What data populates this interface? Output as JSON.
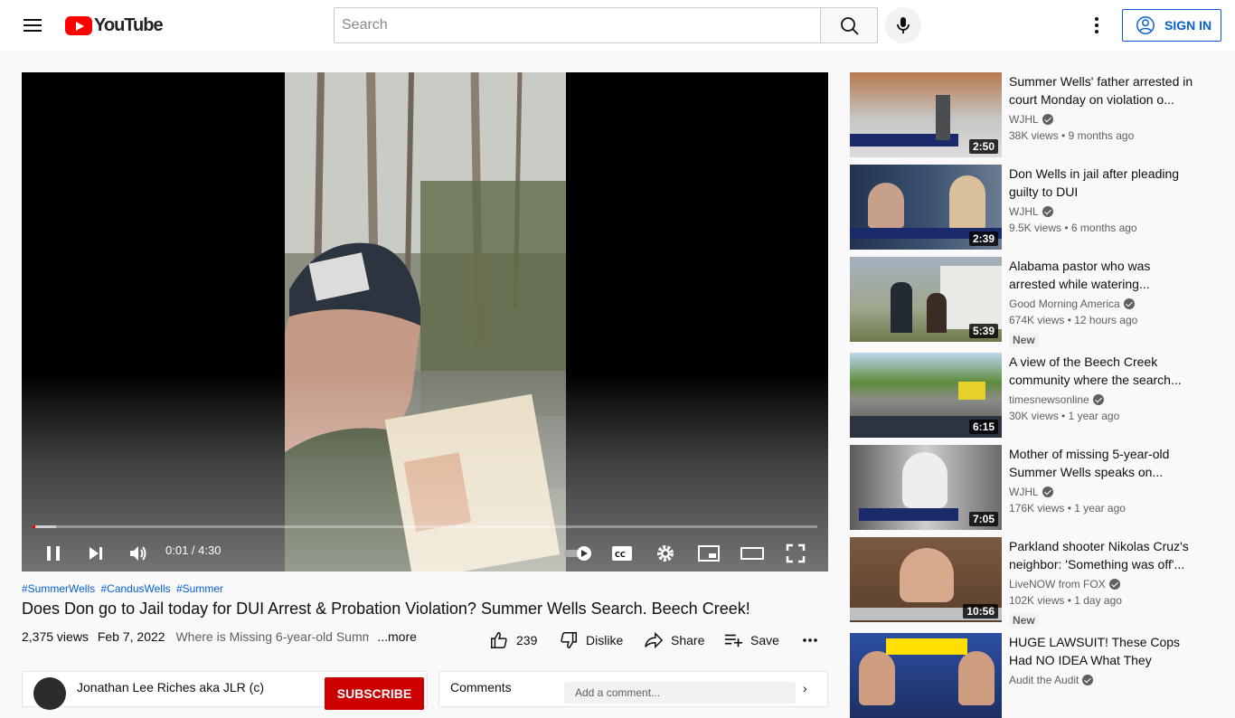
{
  "header": {
    "logo_text": "YouTube",
    "search_placeholder": "Search",
    "signin_label": "SIGN IN"
  },
  "player": {
    "current_time": "0:01",
    "total_time": "4:30",
    "time_display": "0:01 / 4:30",
    "played_fraction": 0.004,
    "buffered_fraction": 0.03
  },
  "video": {
    "hashtags": [
      "#SummerWells",
      "#CandusWells",
      "#Summer"
    ],
    "title": "Does Don go to Jail today for DUI Arrest & Probation Violation? Summer Wells Search. Beech Creek!",
    "views": "2,375 views",
    "date": "Feb 7, 2022",
    "description_preview": "Where is Missing 6-year-old Summ",
    "more_label": "...more",
    "likes": "239",
    "dislike_label": "Dislike",
    "share_label": "Share",
    "save_label": "Save"
  },
  "channel": {
    "name": "Jonathan Lee Riches aka JLR (c)",
    "subscribe_label": "SUBSCRIBE"
  },
  "comments": {
    "label": "Comments",
    "input_placeholder": "Add a comment..."
  },
  "recommendations": [
    {
      "title": "Summer Wells' father arrested in court Monday on violation o...",
      "channel": "WJHL",
      "verified": true,
      "meta": "38K views • 9 months ago",
      "duration": "2:50",
      "badge": ""
    },
    {
      "title": "Don Wells in jail after pleading guilty to DUI",
      "channel": "WJHL",
      "verified": true,
      "meta": "9.5K views • 6 months ago",
      "duration": "2:39",
      "badge": ""
    },
    {
      "title": "Alabama pastor who was arrested while watering...",
      "channel": "Good Morning America",
      "verified": true,
      "meta": "674K views • 12 hours ago",
      "duration": "5:39",
      "badge": "New"
    },
    {
      "title": "A view of the Beech Creek community where the search...",
      "channel": "timesnewsonline",
      "verified": true,
      "meta": "30K views • 1 year ago",
      "duration": "6:15",
      "badge": ""
    },
    {
      "title": "Mother of missing 5-year-old Summer Wells speaks on...",
      "channel": "WJHL",
      "verified": true,
      "meta": "176K views • 1 year ago",
      "duration": "7:05",
      "badge": ""
    },
    {
      "title": "Parkland shooter Nikolas Cruz's neighbor: 'Something was off'...",
      "channel": "LiveNOW from FOX",
      "verified": true,
      "meta": "102K views • 1 day ago",
      "duration": "10:56",
      "badge": "New"
    },
    {
      "title": "HUGE LAWSUIT! These Cops Had NO IDEA What They Were...",
      "channel": "Audit the Audit",
      "verified": true,
      "meta": "",
      "duration": "",
      "badge": ""
    }
  ],
  "colors": {
    "brand_red": "#ff0000",
    "link_blue": "#065fd4",
    "subscribe_red": "#cc0000"
  }
}
